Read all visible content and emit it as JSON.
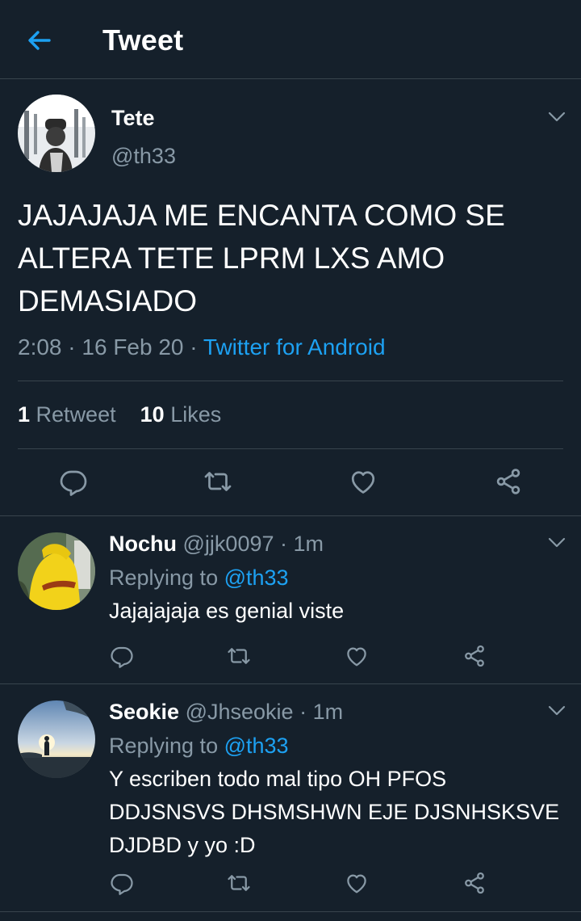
{
  "header": {
    "title": "Tweet",
    "back_icon": "arrow-left-icon"
  },
  "tweet": {
    "name": "Tete",
    "handle": "@th33",
    "text": "JAJAJAJA ME ENCANTA COMO SE ALTERA TETE LPRM LXS AMO DEMASIADO",
    "time": "2:08",
    "date": "16 Feb 20",
    "source": "Twitter for Android",
    "retweet_count": "1",
    "retweet_label": "Retweet",
    "like_count": "10",
    "like_label": "Likes"
  },
  "replies": [
    {
      "name": "Nochu",
      "handle": "@jjk0097",
      "age": "1m",
      "replying_label": "Replying to",
      "replying_to": "@th33",
      "text": "Jajajajaja es genial viste"
    },
    {
      "name": "Seokie",
      "handle": "@Jhseokie",
      "age": "1m",
      "replying_label": "Replying to",
      "replying_to": "@th33",
      "text": "Y escriben todo mal tipo OH PFOS\nDDJSNSVS  DHSMSHWN EJE DJSNHSKSVE\nDJDBD y yo :D"
    }
  ],
  "colors": {
    "background": "#15202b",
    "accent": "#1da1f2",
    "muted": "#8899a6",
    "divider": "#38444d"
  }
}
